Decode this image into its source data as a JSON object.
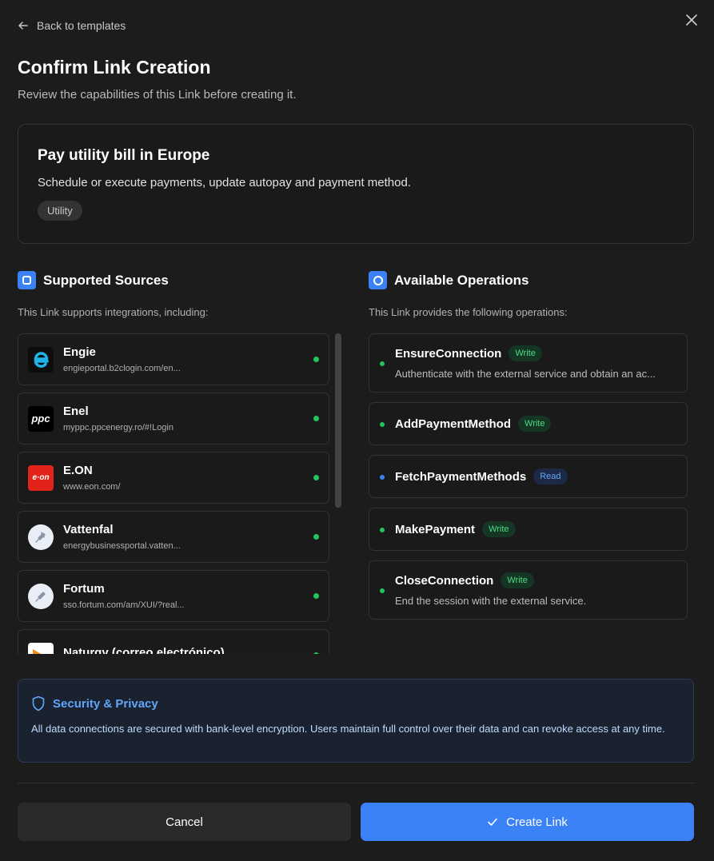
{
  "nav": {
    "back_label": "Back to templates"
  },
  "header": {
    "title": "Confirm Link Creation",
    "subtitle": "Review the capabilities of this Link before creating it."
  },
  "template": {
    "name": "Pay utility bill in Europe",
    "description": "Schedule or execute payments, update autopay and payment method.",
    "tag": "Utility"
  },
  "sources": {
    "heading": "Supported Sources",
    "description": "This Link supports integrations, including:",
    "items": [
      {
        "name": "Engie",
        "url": "engieportal.b2clogin.com/en...",
        "icon": "engie-logo"
      },
      {
        "name": "Enel",
        "url": "myppc.ppcenergy.ro/#!Login",
        "icon": "ppc-logo",
        "logo_text": "ppc"
      },
      {
        "name": "E.ON",
        "url": "www.eon.com/",
        "icon": "eon-logo",
        "logo_text": "e·on"
      },
      {
        "name": "Vattenfal",
        "url": "energybusinessportal.vatten...",
        "icon": "plug-icon"
      },
      {
        "name": "Fortum",
        "url": "sso.fortum.com/am/XUI/?real...",
        "icon": "plug-icon"
      },
      {
        "name": "Naturgy (correo electrónico)",
        "url": "",
        "icon": "naturgy-logo"
      }
    ]
  },
  "operations": {
    "heading": "Available Operations",
    "description": "This Link provides the following operations:",
    "items": [
      {
        "name": "EnsureConnection",
        "type": "Write",
        "description": "Authenticate with the external service and obtain an ac..."
      },
      {
        "name": "AddPaymentMethod",
        "type": "Write",
        "description": ""
      },
      {
        "name": "FetchPaymentMethods",
        "type": "Read",
        "description": ""
      },
      {
        "name": "MakePayment",
        "type": "Write",
        "description": ""
      },
      {
        "name": "CloseConnection",
        "type": "Write",
        "description": "End the session with the external service."
      }
    ]
  },
  "security": {
    "title": "Security & Privacy",
    "text": "All data connections are secured with bank-level encryption. Users maintain full control over their data and can revoke access at any time."
  },
  "actions": {
    "cancel": "Cancel",
    "create": "Create Link"
  },
  "colors": {
    "accent": "#3b82f6",
    "status_green": "#22c55e",
    "read_blue": "#60a5fa",
    "write_green": "#4ade80"
  }
}
